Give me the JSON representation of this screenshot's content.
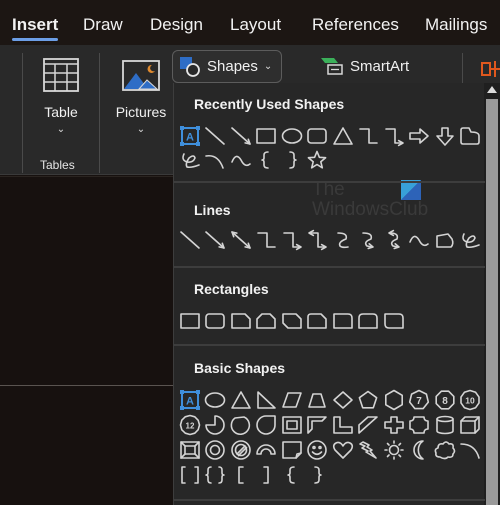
{
  "tabs": [
    {
      "label": "Insert",
      "active": true
    },
    {
      "label": "Draw",
      "active": false
    },
    {
      "label": "Design",
      "active": false
    },
    {
      "label": "Layout",
      "active": false
    },
    {
      "label": "References",
      "active": false
    },
    {
      "label": "Mailings",
      "active": false
    }
  ],
  "ribbon": {
    "table_label": "Table",
    "pictures_label": "Pictures",
    "tables_group_label": "Tables",
    "shapes_label": "Shapes",
    "smartart_label": "SmartArt",
    "chevron": "⌄"
  },
  "colors": {
    "accent": "#6c9ee6",
    "selection": "#3f8fdc",
    "panel_bg": "#272727",
    "ribbon_bg": "#292929"
  },
  "watermark": {
    "line1": "The",
    "line2": "WindowsClub"
  },
  "shapes_panel": {
    "sections": [
      {
        "title": "Recently Used Shapes",
        "rows": [
          [
            "text-box",
            "line",
            "line-arrow",
            "rectangle",
            "oval",
            "rounded-rectangle",
            "triangle",
            "elbow-connector",
            "elbow-arrow-connector",
            "right-arrow",
            "down-arrow",
            "flowchart-shape"
          ],
          [
            "scribble",
            "arc-curve",
            "curve",
            "left-brace",
            "right-brace",
            "star"
          ]
        ]
      },
      {
        "title": "Lines",
        "rows": [
          [
            "line",
            "line-arrow",
            "line-double-arrow",
            "elbow-connector",
            "elbow-arrow-connector",
            "elbow-double-arrow-connector",
            "curved-connector",
            "curved-arrow-connector",
            "curved-double-arrow-connector",
            "curve",
            "freeform",
            "scribble"
          ]
        ]
      },
      {
        "title": "Rectangles",
        "rows": [
          [
            "rectangle",
            "rounded-rectangle",
            "snip-single-corner",
            "snip-same-side",
            "snip-diagonal",
            "snip-round-single",
            "round-single-corner",
            "round-same-side",
            "round-diagonal"
          ]
        ]
      },
      {
        "title": "Basic Shapes",
        "rows": [
          [
            "text-box",
            "oval",
            "isosceles-triangle",
            "right-triangle",
            "parallelogram",
            "trapezoid",
            "diamond",
            "pentagon",
            "hexagon",
            "heptagon",
            "octagon",
            "decagon"
          ],
          [
            "dodecagon",
            "pie",
            "chord",
            "teardrop",
            "frame",
            "half-frame",
            "l-shape",
            "diagonal-stripe",
            "cross",
            "plaque",
            "can",
            "cube"
          ],
          [
            "bevel",
            "donut",
            "no-symbol",
            "block-arc",
            "folded-corner",
            "smiley-face",
            "heart",
            "lightning-bolt",
            "sun",
            "moon",
            "cloud",
            "arc"
          ],
          [
            "double-bracket",
            "double-brace",
            "left-bracket",
            "right-bracket",
            "left-brace",
            "right-brace"
          ]
        ]
      }
    ],
    "number_labels": {
      "heptagon": "7",
      "octagon": "8",
      "decagon": "10",
      "dodecagon": "12",
      "text-box": "A"
    }
  }
}
